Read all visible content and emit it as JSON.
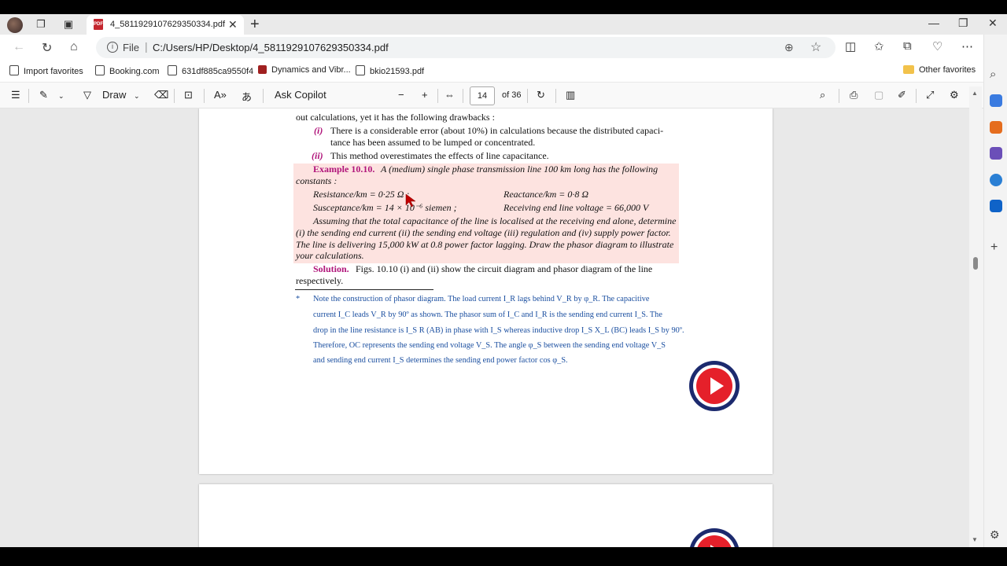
{
  "browser": {
    "tab_title": "4_5811929107629350334.pdf",
    "address_scheme": "File",
    "address_url": "C:/Users/HP/Desktop/4_5811929107629350334.pdf"
  },
  "favorites": [
    {
      "label": "Import favorites"
    },
    {
      "label": "Booking.com"
    },
    {
      "label": "631df885ca9550f4"
    },
    {
      "label": "Dynamics and Vibr..."
    },
    {
      "label": "bkio21593.pdf"
    }
  ],
  "other_favorites": "Other favorites",
  "pdf_toolbar": {
    "draw_label": "Draw",
    "copilot_label": "Ask Copilot",
    "page_current": "14",
    "page_total": "of 36"
  },
  "doc": {
    "line1": "out calculations, yet it has the following drawbacks :",
    "i_mark": "(i)",
    "i_text1": "There is a considerable error (about 10%) in calculations because the distributed capaci-",
    "i_text2": "tance has been assumed to be lumped or concentrated.",
    "ii_mark": "(ii)",
    "ii_text": "This method overestimates the effects of line capacitance.",
    "example_label": "Example 10.10.",
    "ex_line1": "A (medium) single phase transmission line 100 km long has the following",
    "ex_line2": "constants :",
    "resistance": "Resistance/km = 0·25 Ω ;",
    "reactance": "Reactance/km = 0·8 Ω",
    "susceptance": "Susceptance/km = 14 × 10⁻⁶ siemen ;",
    "receiving": "Receiving end line voltage = 66,000 V",
    "assume1": "Assuming that the total capacitance of the line is localised at the receiving end alone, determine",
    "assume2": "(i) the sending end current (ii) the sending end voltage (iii) regulation and (iv) supply power factor.",
    "assume3": "The line is delivering 15,000 kW at 0.8 power factor lagging. Draw the phasor diagram to illustrate",
    "assume4": "your calculations.",
    "solution_label": "Solution.",
    "sol_line1": "Figs. 10.10 (i) and (ii) show the circuit diagram and phasor diagram of the line",
    "sol_line2": "respectively.",
    "foot_star": "*",
    "foot1": "Note the construction of phasor diagram. The load current I_R lags behind V_R by φ_R. The capacitive",
    "foot2": "current I_C leads V_R by 90º as shown. The phasor sum of I_C and I_R is the sending end current I_S. The",
    "foot3": "drop in the line resistance is I_S R (AB) in phase with I_S whereas inductive drop I_S X_L (BC) leads I_S by 90º.",
    "foot4": "Therefore, OC represents the sending end voltage V_S. The angle φ_S between the sending end voltage V_S",
    "foot5": "and sending end current I_S determines the sending end power factor cos φ_S."
  },
  "colors": {
    "accent_magenta": "#b0147a",
    "footnote_blue": "#1b4fa0",
    "highlight_pink": "#fde3e0",
    "play_red": "#e5202a"
  }
}
